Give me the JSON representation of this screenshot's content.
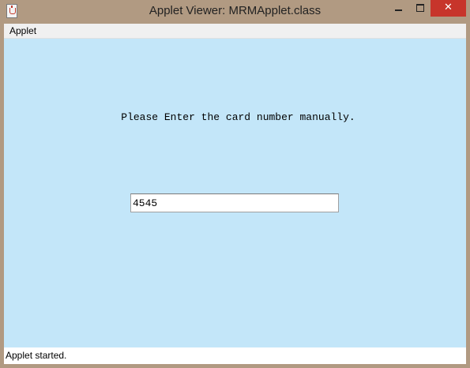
{
  "window": {
    "title": "Applet Viewer: MRMApplet.class",
    "icon": "java-icon",
    "controls": {
      "minimize_icon": "minimize-icon",
      "maximize_icon": "maximize-icon",
      "close_label": "✕"
    }
  },
  "menubar": {
    "items": [
      {
        "label": "Applet"
      }
    ]
  },
  "applet": {
    "background_color": "#c3e6f9",
    "prompt": "Please Enter the card number manually.",
    "card_input": {
      "value": "4545",
      "placeholder": ""
    }
  },
  "status": {
    "text": "Applet started."
  },
  "colors": {
    "titlebar": "#b19a82",
    "close_button": "#c7352b"
  }
}
